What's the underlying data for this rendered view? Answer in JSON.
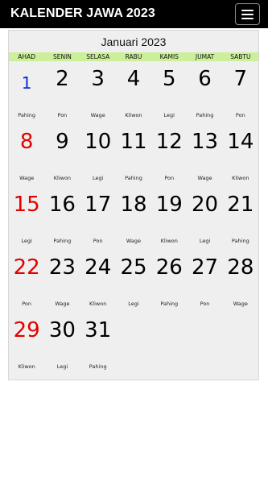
{
  "app": {
    "title": "KALENDER JAWA 2023",
    "menu_icon": "hamburger-icon"
  },
  "calendar": {
    "month": "Januari 2023",
    "weekdays": [
      "AHAD",
      "SENIN",
      "SELASA",
      "RABU",
      "KAMIS",
      "JUMAT",
      "SABTU"
    ],
    "colors": {
      "sunday": "#e20000",
      "highlight": "#0a2bd6",
      "header_bg": "#ccf09a"
    },
    "weeks": [
      [
        {
          "day": "1",
          "pasaran": "Pahing"
        },
        {
          "day": "2",
          "pasaran": "Pon"
        },
        {
          "day": "3",
          "pasaran": "Wage"
        },
        {
          "day": "4",
          "pasaran": "Kliwon"
        },
        {
          "day": "5",
          "pasaran": "Legi"
        },
        {
          "day": "6",
          "pasaran": "Pahing"
        },
        {
          "day": "7",
          "pasaran": "Pon"
        }
      ],
      [
        {
          "day": "8",
          "pasaran": "Wage"
        },
        {
          "day": "9",
          "pasaran": "Kliwon"
        },
        {
          "day": "10",
          "pasaran": "Legi"
        },
        {
          "day": "11",
          "pasaran": "Pahing"
        },
        {
          "day": "12",
          "pasaran": "Pon"
        },
        {
          "day": "13",
          "pasaran": "Wage"
        },
        {
          "day": "14",
          "pasaran": "Kliwon"
        }
      ],
      [
        {
          "day": "15",
          "pasaran": "Legi"
        },
        {
          "day": "16",
          "pasaran": "Pahing"
        },
        {
          "day": "17",
          "pasaran": "Pon"
        },
        {
          "day": "18",
          "pasaran": "Wage"
        },
        {
          "day": "19",
          "pasaran": "Kliwon"
        },
        {
          "day": "20",
          "pasaran": "Legi"
        },
        {
          "day": "21",
          "pasaran": "Pahing"
        }
      ],
      [
        {
          "day": "22",
          "pasaran": "Pon"
        },
        {
          "day": "23",
          "pasaran": "Wage"
        },
        {
          "day": "24",
          "pasaran": "Kliwon"
        },
        {
          "day": "25",
          "pasaran": "Legi"
        },
        {
          "day": "26",
          "pasaran": "Pahing"
        },
        {
          "day": "27",
          "pasaran": "Pon"
        },
        {
          "day": "28",
          "pasaran": "Wage"
        }
      ],
      [
        {
          "day": "29",
          "pasaran": "Kliwon"
        },
        {
          "day": "30",
          "pasaran": "Legi"
        },
        {
          "day": "31",
          "pasaran": "Pahing"
        },
        {
          "day": "",
          "pasaran": ""
        },
        {
          "day": "",
          "pasaran": ""
        },
        {
          "day": "",
          "pasaran": ""
        },
        {
          "day": "",
          "pasaran": ""
        }
      ]
    ]
  }
}
